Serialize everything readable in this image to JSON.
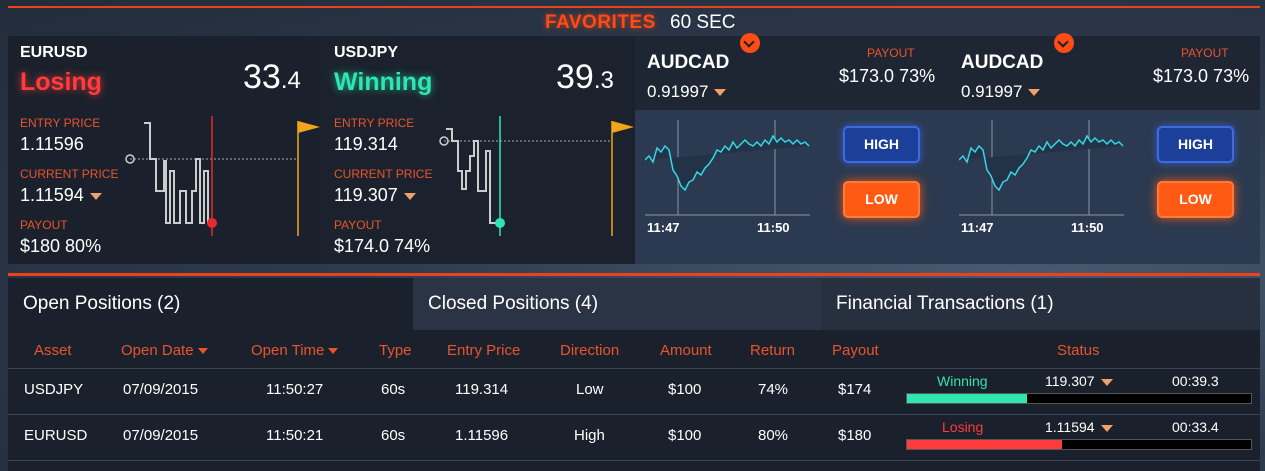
{
  "favorites": {
    "title": "FAVORITES",
    "timer": "60 SEC"
  },
  "cards": [
    {
      "asset": "EURUSD",
      "state": "Losing",
      "countdown_main": "33",
      "countdown_frac": ".4",
      "entry_label": "ENTRY PRICE",
      "entry_price": "1.11596",
      "current_label": "CURRENT PRICE",
      "current_price": "1.11594",
      "payout_label": "PAYOUT",
      "payout": "$180 80%"
    },
    {
      "asset": "USDJPY",
      "state": "Winning",
      "countdown_main": "39",
      "countdown_frac": ".3",
      "entry_label": "ENTRY PRICE",
      "entry_price": "119.314",
      "current_label": "CURRENT PRICE",
      "current_price": "119.307",
      "payout_label": "PAYOUT",
      "payout": "$174.0 74%"
    }
  ],
  "trade_panels": [
    {
      "asset": "AUDCAD",
      "price": "0.91997",
      "payout_label": "PAYOUT",
      "payout": "$173.0 73%",
      "high_label": "HIGH",
      "low_label": "LOW",
      "time_ticks": [
        "11:47",
        "11:50"
      ]
    },
    {
      "asset": "AUDCAD",
      "price": "0.91997",
      "payout_label": "PAYOUT",
      "payout": "$173.0 73%",
      "high_label": "HIGH",
      "low_label": "LOW",
      "time_ticks": [
        "11:47",
        "11:50"
      ]
    }
  ],
  "tabs": [
    {
      "label": "Open Positions (2)"
    },
    {
      "label": "Closed Positions (4)"
    },
    {
      "label": "Financial Transactions (1)"
    }
  ],
  "table": {
    "headers": [
      "Asset",
      "Open Date",
      "Open Time",
      "Type",
      "Entry Price",
      "Direction",
      "Amount",
      "Return",
      "Payout",
      "Status"
    ],
    "rows": [
      {
        "asset": "USDJPY",
        "open_date": "07/09/2015",
        "open_time": "11:50:27",
        "type": "60s",
        "entry_price": "119.314",
        "direction": "Low",
        "amount": "$100",
        "return": "74%",
        "payout": "$174",
        "status_label": "Winning",
        "status_price": "119.307",
        "status_time": "00:39.3",
        "progress": 0.35
      },
      {
        "asset": "EURUSD",
        "open_date": "07/09/2015",
        "open_time": "11:50:21",
        "type": "60s",
        "entry_price": "1.11596",
        "direction": "High",
        "amount": "$100",
        "return": "80%",
        "payout": "$180",
        "status_label": "Losing",
        "status_price": "1.11594",
        "status_time": "00:33.4",
        "progress": 0.45
      }
    ]
  },
  "colors": {
    "accent": "#e8431b",
    "win": "#2ee6b0",
    "lose": "#ff3b3b",
    "high": "#1c3f9a",
    "low": "#ff5a14"
  }
}
